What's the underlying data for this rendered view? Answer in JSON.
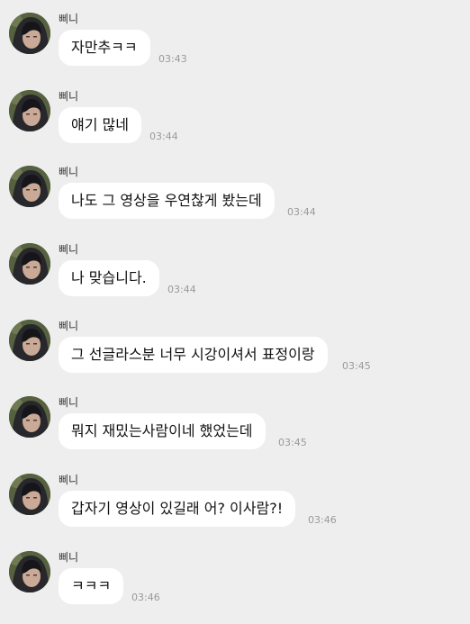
{
  "colors": {
    "background": "#eeeeee",
    "bubble": "#ffffff",
    "timestamp": "#9a9a9a"
  },
  "messages": [
    {
      "sender": "삐니",
      "avatar_icon": "profile-photo-icon",
      "text": "자만추ㅋㅋ",
      "time": "03:43"
    },
    {
      "sender": "삐니",
      "avatar_icon": "profile-photo-icon",
      "text": "얘기 많네",
      "time": "03:44"
    },
    {
      "sender": "삐니",
      "avatar_icon": "profile-photo-icon",
      "text": "나도 그 영상을 우연찮게 봤는데",
      "time": "03:44"
    },
    {
      "sender": "삐니",
      "avatar_icon": "profile-photo-icon",
      "text": "나 맞습니다.",
      "time": "03:44"
    },
    {
      "sender": "삐니",
      "avatar_icon": "profile-photo-icon",
      "text": "그 선글라스분 너무 시강이셔서 표정이랑",
      "time": "03:45"
    },
    {
      "sender": "삐니",
      "avatar_icon": "profile-photo-icon",
      "text": "뭐지 재밌는사람이네 했었는데",
      "time": "03:45"
    },
    {
      "sender": "삐니",
      "avatar_icon": "profile-photo-icon",
      "text": "갑자기 영상이 있길래 어? 이사람?!",
      "time": "03:46"
    },
    {
      "sender": "삐니",
      "avatar_icon": "profile-photo-icon",
      "text": "ㅋㅋㅋ",
      "time": "03:46"
    }
  ]
}
